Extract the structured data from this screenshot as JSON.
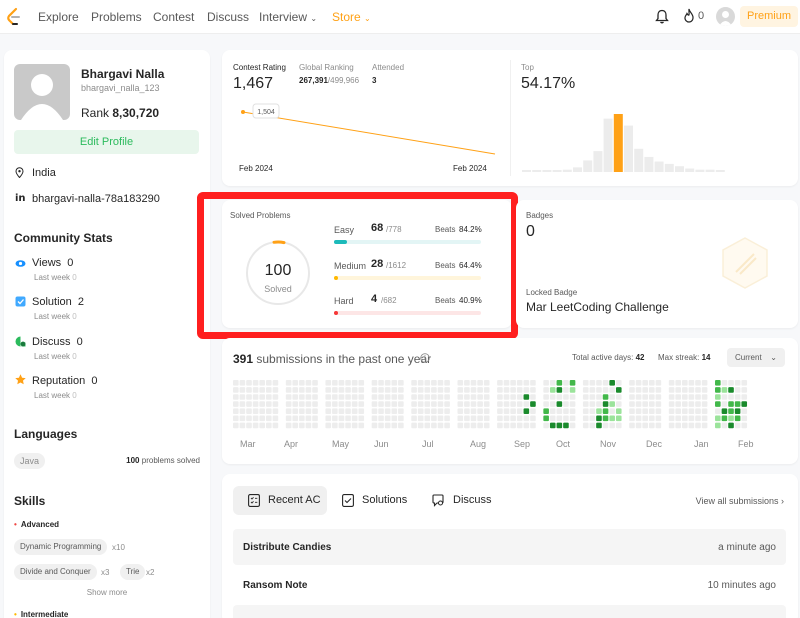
{
  "nav": {
    "links": [
      "Explore",
      "Problems",
      "Contest",
      "Discuss",
      "Interview",
      "Store"
    ],
    "fire_count": "0",
    "premium": "Premium"
  },
  "profile": {
    "name": "Bhargavi Nalla",
    "handle": "bhargavi_nalla_123",
    "rank_label": "Rank",
    "rank_value": "8,30,720",
    "edit_button": "Edit Profile",
    "location": "India",
    "linkedin": "bhargavi-nalla-78a183290",
    "linkedin_icon": "in"
  },
  "community": {
    "title": "Community Stats",
    "items": [
      {
        "label": "Views",
        "value": "0",
        "sub": "Last week",
        "sub_value": "0",
        "icon": "eye-icon",
        "color": "#1890ff"
      },
      {
        "label": "Solution",
        "value": "2",
        "sub": "Last week",
        "sub_value": "0",
        "icon": "solution-icon",
        "color": "#40a9ff"
      },
      {
        "label": "Discuss",
        "value": "0",
        "sub": "Last week",
        "sub_value": "0",
        "icon": "discuss-icon",
        "color": "#2cbb5d"
      },
      {
        "label": "Reputation",
        "value": "0",
        "sub": "Last week",
        "sub_value": "0",
        "icon": "star-icon",
        "color": "#ffa116"
      }
    ]
  },
  "languages": {
    "title": "Languages",
    "tag": "Java",
    "count": "100",
    "count_suffix": "problems solved"
  },
  "skills": {
    "title": "Skills",
    "advanced": "Advanced",
    "intermediate": "Intermediate",
    "tags": [
      {
        "name": "Dynamic Programming",
        "count": "x10"
      },
      {
        "name": "Divide and Conquer",
        "count": "x3"
      },
      {
        "name": "Trie",
        "count": "x2"
      }
    ],
    "show_more": "Show more"
  },
  "contest": {
    "rating_label": "Contest Rating",
    "rating_value": "1,467",
    "global_label": "Global Ranking",
    "global_rank": "267,391",
    "global_total": "/499,966",
    "attended_label": "Attended",
    "attended_value": "3",
    "point_label": "1,504",
    "date_start": "Feb 2024",
    "date_end": "Feb 2024",
    "top_label": "Top",
    "top_value": "54.17%",
    "histogram": [
      1,
      1,
      1,
      1,
      2,
      4,
      10,
      18,
      46,
      50,
      40,
      20,
      13,
      9,
      7,
      5,
      3,
      2,
      2,
      1
    ],
    "histogram_highlight_index": 9
  },
  "solved": {
    "title": "Solved Problems",
    "total": "100",
    "total_label": "Solved",
    "easy": {
      "label": "Easy",
      "count": "68",
      "total": "/778",
      "beats_label": "Beats",
      "beats": "84.2%",
      "fraction": 0.087,
      "color": "#1cbaba",
      "track": "#e3f5f5"
    },
    "medium": {
      "label": "Medium",
      "count": "28",
      "total": "/1612",
      "beats_label": "Beats",
      "beats": "64.4%",
      "fraction": 0.017,
      "color": "#ffb800",
      "track": "#fff5db"
    },
    "hard": {
      "label": "Hard",
      "count": "4",
      "total": "/682",
      "beats_label": "Beats",
      "beats": "40.9%",
      "fraction": 0.006,
      "color": "#f63737",
      "track": "#fde6e6"
    }
  },
  "badges": {
    "title": "Badges",
    "count": "0",
    "locked_label": "Locked Badge",
    "locked_name": "Mar LeetCoding Challenge"
  },
  "submissions": {
    "count": "391",
    "suffix": "submissions in the past one year",
    "active_label": "Total active days:",
    "active_days": "42",
    "streak_label": "Max streak:",
    "streak": "14",
    "range": "Current",
    "months": [
      "Mar",
      "Apr",
      "May",
      "Jun",
      "Jul",
      "Aug",
      "Sep",
      "Oct",
      "Nov",
      "Dec",
      "Jan",
      "Feb"
    ]
  },
  "recent": {
    "tabs": [
      "Recent AC",
      "Solutions",
      "Discuss"
    ],
    "view_all": "View all submissions",
    "rows": [
      {
        "title": "Distribute Candies",
        "time": "a minute ago"
      },
      {
        "title": "Ransom Note",
        "time": "10 minutes ago"
      }
    ]
  }
}
